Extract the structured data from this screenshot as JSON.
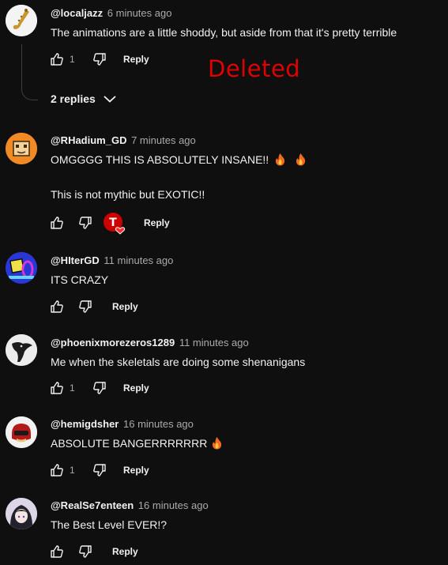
{
  "overlay": {
    "deleted_label": "Deleted"
  },
  "comments": [
    {
      "author": "@localjazz",
      "time": "6 minutes ago",
      "lines": [
        "The animations are a little shoddy, but aside from that it's pretty terrible"
      ],
      "likes": "1",
      "reply_label": "Reply",
      "replies_label": "2 replies"
    },
    {
      "author": "@RHadium_GD",
      "time": "7 minutes ago",
      "lines": [
        "OMGGGG THIS IS ABSOLUTELY INSANE!!",
        "This is not mythic but EXOTIC!!"
      ],
      "likes": "",
      "reply_label": "Reply",
      "creator_heart_letter": "T"
    },
    {
      "author": "@HIterGD",
      "time": "11 minutes ago",
      "lines": [
        "ITS CRAZY"
      ],
      "likes": "",
      "reply_label": "Reply"
    },
    {
      "author": "@phoenixmorezeros1289",
      "time": "11 minutes ago",
      "lines": [
        "Me when the skeletals are doing some shenanigans"
      ],
      "likes": "1",
      "reply_label": "Reply"
    },
    {
      "author": "@hemigdsher",
      "time": "16 minutes ago",
      "lines": [
        "ABSOLUTE BANGERRRRRRR"
      ],
      "likes": "1",
      "reply_label": "Reply"
    },
    {
      "author": "@RealSe7enteen",
      "time": "16 minutes ago",
      "lines": [
        "The Best Level EVER!?"
      ],
      "likes": "",
      "reply_label": "Reply"
    }
  ],
  "icons": {
    "like": "thumb-up-icon",
    "dislike": "thumb-down-icon",
    "fire": "fire-emoji-icon",
    "chevron": "chevron-down-icon"
  },
  "colors": {
    "background": "#0f0f0f",
    "text": "#f1f1f1",
    "muted": "#aaaaaa",
    "deleted": "#e00000",
    "heart_badge": "#cc0000"
  }
}
